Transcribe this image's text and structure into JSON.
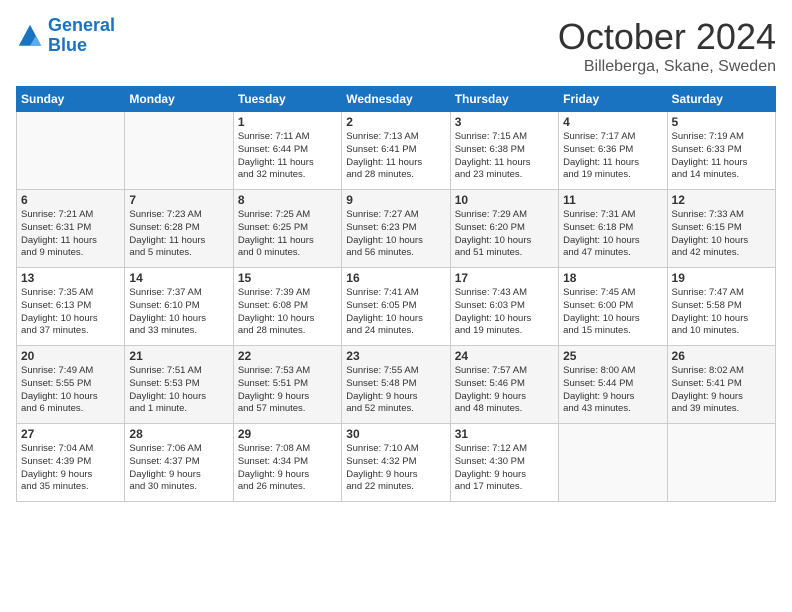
{
  "header": {
    "logo_general": "General",
    "logo_blue": "Blue",
    "month_title": "October 2024",
    "subtitle": "Billeberga, Skane, Sweden"
  },
  "weekdays": [
    "Sunday",
    "Monday",
    "Tuesday",
    "Wednesday",
    "Thursday",
    "Friday",
    "Saturday"
  ],
  "weeks": [
    [
      {
        "day": "",
        "info": ""
      },
      {
        "day": "",
        "info": ""
      },
      {
        "day": "1",
        "info": "Sunrise: 7:11 AM\nSunset: 6:44 PM\nDaylight: 11 hours\nand 32 minutes."
      },
      {
        "day": "2",
        "info": "Sunrise: 7:13 AM\nSunset: 6:41 PM\nDaylight: 11 hours\nand 28 minutes."
      },
      {
        "day": "3",
        "info": "Sunrise: 7:15 AM\nSunset: 6:38 PM\nDaylight: 11 hours\nand 23 minutes."
      },
      {
        "day": "4",
        "info": "Sunrise: 7:17 AM\nSunset: 6:36 PM\nDaylight: 11 hours\nand 19 minutes."
      },
      {
        "day": "5",
        "info": "Sunrise: 7:19 AM\nSunset: 6:33 PM\nDaylight: 11 hours\nand 14 minutes."
      }
    ],
    [
      {
        "day": "6",
        "info": "Sunrise: 7:21 AM\nSunset: 6:31 PM\nDaylight: 11 hours\nand 9 minutes."
      },
      {
        "day": "7",
        "info": "Sunrise: 7:23 AM\nSunset: 6:28 PM\nDaylight: 11 hours\nand 5 minutes."
      },
      {
        "day": "8",
        "info": "Sunrise: 7:25 AM\nSunset: 6:25 PM\nDaylight: 11 hours\nand 0 minutes."
      },
      {
        "day": "9",
        "info": "Sunrise: 7:27 AM\nSunset: 6:23 PM\nDaylight: 10 hours\nand 56 minutes."
      },
      {
        "day": "10",
        "info": "Sunrise: 7:29 AM\nSunset: 6:20 PM\nDaylight: 10 hours\nand 51 minutes."
      },
      {
        "day": "11",
        "info": "Sunrise: 7:31 AM\nSunset: 6:18 PM\nDaylight: 10 hours\nand 47 minutes."
      },
      {
        "day": "12",
        "info": "Sunrise: 7:33 AM\nSunset: 6:15 PM\nDaylight: 10 hours\nand 42 minutes."
      }
    ],
    [
      {
        "day": "13",
        "info": "Sunrise: 7:35 AM\nSunset: 6:13 PM\nDaylight: 10 hours\nand 37 minutes."
      },
      {
        "day": "14",
        "info": "Sunrise: 7:37 AM\nSunset: 6:10 PM\nDaylight: 10 hours\nand 33 minutes."
      },
      {
        "day": "15",
        "info": "Sunrise: 7:39 AM\nSunset: 6:08 PM\nDaylight: 10 hours\nand 28 minutes."
      },
      {
        "day": "16",
        "info": "Sunrise: 7:41 AM\nSunset: 6:05 PM\nDaylight: 10 hours\nand 24 minutes."
      },
      {
        "day": "17",
        "info": "Sunrise: 7:43 AM\nSunset: 6:03 PM\nDaylight: 10 hours\nand 19 minutes."
      },
      {
        "day": "18",
        "info": "Sunrise: 7:45 AM\nSunset: 6:00 PM\nDaylight: 10 hours\nand 15 minutes."
      },
      {
        "day": "19",
        "info": "Sunrise: 7:47 AM\nSunset: 5:58 PM\nDaylight: 10 hours\nand 10 minutes."
      }
    ],
    [
      {
        "day": "20",
        "info": "Sunrise: 7:49 AM\nSunset: 5:55 PM\nDaylight: 10 hours\nand 6 minutes."
      },
      {
        "day": "21",
        "info": "Sunrise: 7:51 AM\nSunset: 5:53 PM\nDaylight: 10 hours\nand 1 minute."
      },
      {
        "day": "22",
        "info": "Sunrise: 7:53 AM\nSunset: 5:51 PM\nDaylight: 9 hours\nand 57 minutes."
      },
      {
        "day": "23",
        "info": "Sunrise: 7:55 AM\nSunset: 5:48 PM\nDaylight: 9 hours\nand 52 minutes."
      },
      {
        "day": "24",
        "info": "Sunrise: 7:57 AM\nSunset: 5:46 PM\nDaylight: 9 hours\nand 48 minutes."
      },
      {
        "day": "25",
        "info": "Sunrise: 8:00 AM\nSunset: 5:44 PM\nDaylight: 9 hours\nand 43 minutes."
      },
      {
        "day": "26",
        "info": "Sunrise: 8:02 AM\nSunset: 5:41 PM\nDaylight: 9 hours\nand 39 minutes."
      }
    ],
    [
      {
        "day": "27",
        "info": "Sunrise: 7:04 AM\nSunset: 4:39 PM\nDaylight: 9 hours\nand 35 minutes."
      },
      {
        "day": "28",
        "info": "Sunrise: 7:06 AM\nSunset: 4:37 PM\nDaylight: 9 hours\nand 30 minutes."
      },
      {
        "day": "29",
        "info": "Sunrise: 7:08 AM\nSunset: 4:34 PM\nDaylight: 9 hours\nand 26 minutes."
      },
      {
        "day": "30",
        "info": "Sunrise: 7:10 AM\nSunset: 4:32 PM\nDaylight: 9 hours\nand 22 minutes."
      },
      {
        "day": "31",
        "info": "Sunrise: 7:12 AM\nSunset: 4:30 PM\nDaylight: 9 hours\nand 17 minutes."
      },
      {
        "day": "",
        "info": ""
      },
      {
        "day": "",
        "info": ""
      }
    ]
  ]
}
